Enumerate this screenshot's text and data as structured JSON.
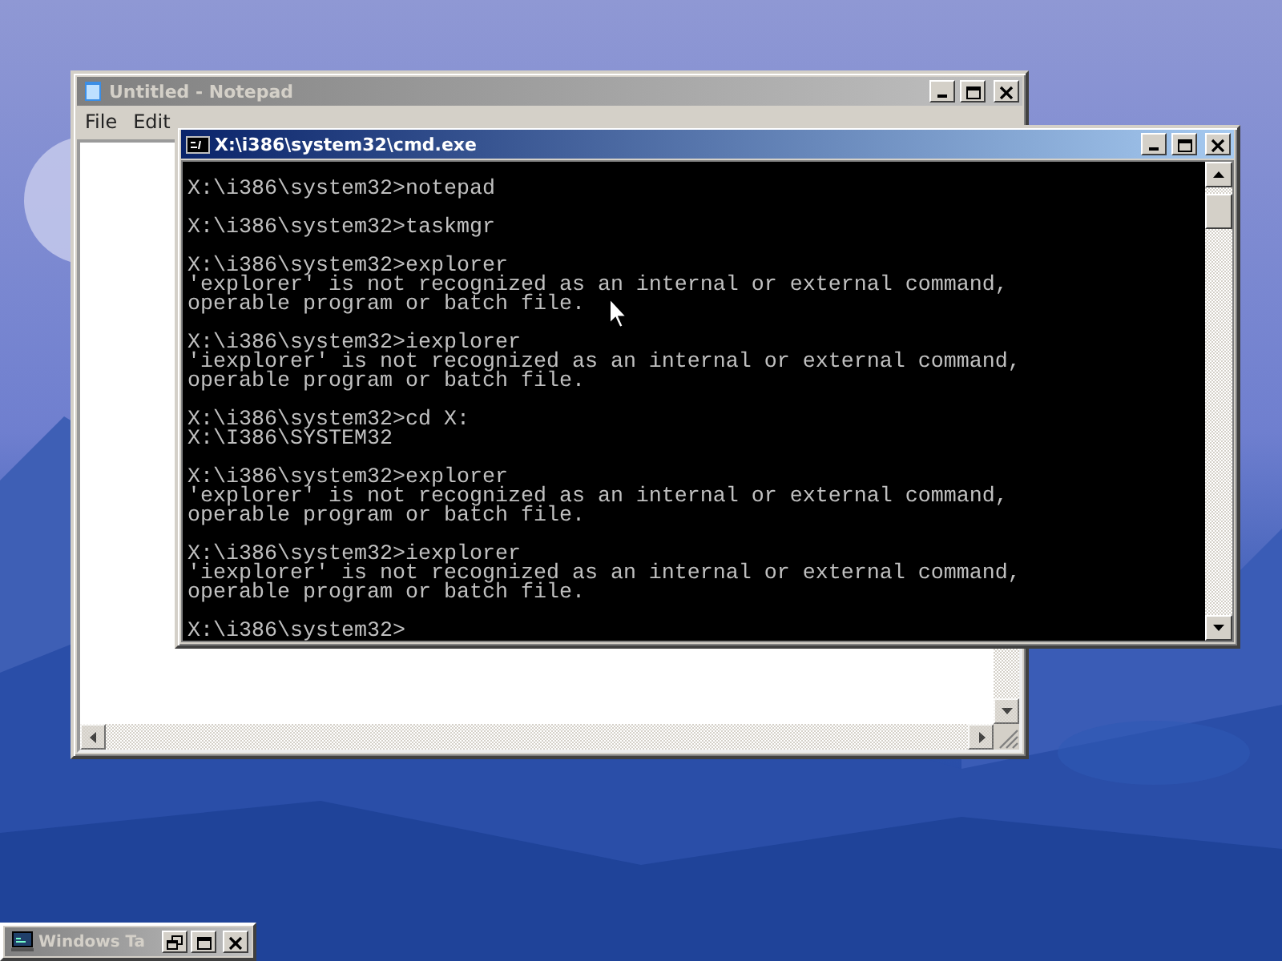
{
  "notepad": {
    "title": "Untitled - Notepad",
    "active": false,
    "menu": [
      "File",
      "Edit"
    ]
  },
  "cmd": {
    "title": "X:\\i386\\system32\\cmd.exe",
    "active": true,
    "blocks": [
      [
        "X:\\i386\\system32>notepad"
      ],
      [
        "X:\\i386\\system32>taskmgr"
      ],
      [
        "X:\\i386\\system32>explorer",
        "'explorer' is not recognized as an internal or external command,",
        "operable program or batch file."
      ],
      [
        "X:\\i386\\system32>iexplorer",
        "'iexplorer' is not recognized as an internal or external command,",
        "operable program or batch file."
      ],
      [
        "X:\\i386\\system32>cd X:",
        "X:\\I386\\SYSTEM32"
      ],
      [
        "X:\\i386\\system32>explorer",
        "'explorer' is not recognized as an internal or external command,",
        "operable program or batch file."
      ],
      [
        "X:\\i386\\system32>iexplorer",
        "'iexplorer' is not recognized as an internal or external command,",
        "operable program or batch file."
      ],
      [
        "X:\\i386\\system32>"
      ]
    ]
  },
  "minimized": {
    "title": "Windows Ta",
    "active": false
  }
}
